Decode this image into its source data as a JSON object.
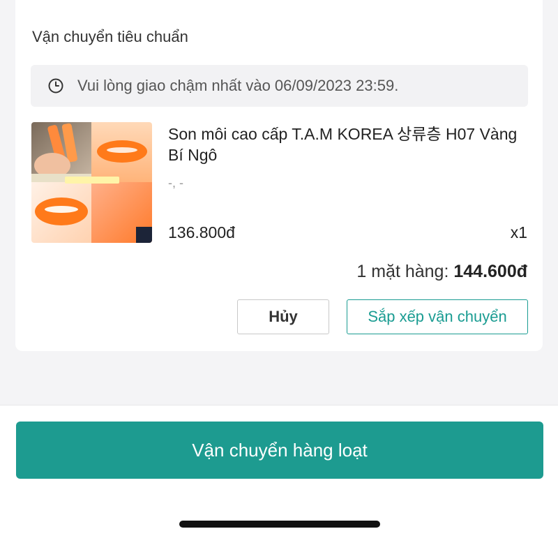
{
  "order": {
    "shipping_method": "Vận chuyển tiêu chuẩn",
    "notice": {
      "icon": "clock-icon",
      "text": "Vui lòng giao chậm nhất vào 06/09/2023 23:59."
    },
    "product": {
      "name": "Son môi cao cấp T.A.M KOREA 상류층 H07 Vàng Bí Ngô",
      "variant": "-, -",
      "price": "136.800đ",
      "quantity": "x1",
      "image": "lipstick-product-image"
    },
    "summary": {
      "label": "1 mặt hàng:",
      "amount": "144.600đ"
    },
    "actions": {
      "cancel_label": "Hủy",
      "arrange_label": "Sắp xếp vận chuyển"
    }
  },
  "bottom": {
    "bulk_ship_label": "Vận chuyển hàng loạt"
  },
  "colors": {
    "accent": "#1d9b90",
    "background": "#f4f4f6",
    "card": "#ffffff"
  }
}
